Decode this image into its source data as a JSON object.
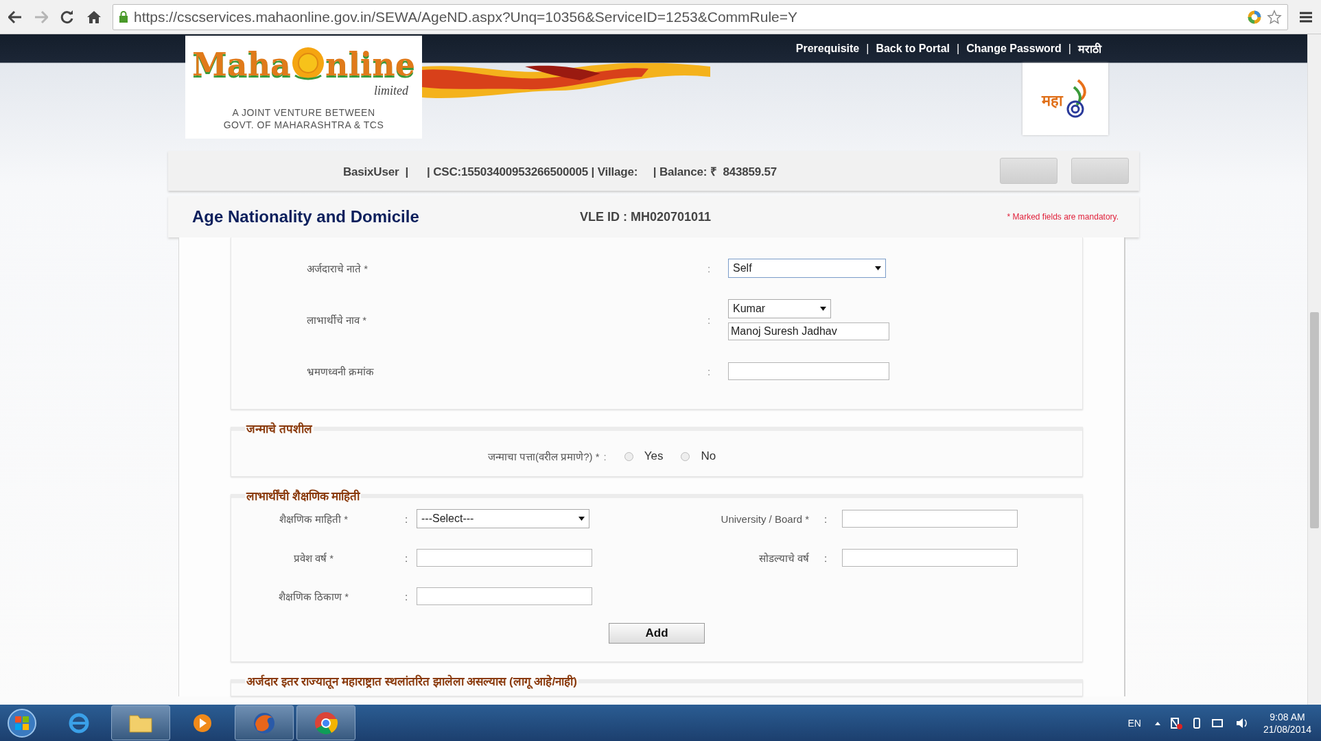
{
  "browser": {
    "url": "https://cscservices.mahaonline.gov.in/SEWA/AgeND.aspx?Unq=10356&ServiceID=1253&CommRule=Y"
  },
  "top_links": [
    "Prerequisite",
    "Back to Portal",
    "Change Password",
    "मराठी"
  ],
  "top_link_dividers": [
    "|",
    "|",
    "|"
  ],
  "logo": {
    "name_left": "Maha",
    "name_right": "nline",
    "suffix": "limited",
    "tagline": [
      "A JOINT VENTURE BETWEEN",
      "GOVT. OF MAHARASHTRA & TCS"
    ]
  },
  "emblem": {
    "text": "महा"
  },
  "user_bar": {
    "line": "BasixUser  |      | CSC:15503400953266500005 | Village:     | Balance: ₹  843859.57"
  },
  "title_bar": {
    "title": "Age Nationality and Domicile",
    "vle_id": "VLE ID : MH020701011",
    "mandatory_note": "* Marked fields are mandatory."
  },
  "applicant_section": {
    "rows": [
      {
        "kind": "select",
        "label": "अर्जदाराचे नाते *",
        "sep": ":",
        "value": "Self"
      },
      {
        "kind": "name",
        "label": "लाभार्थीचे नाव *",
        "sep": ":",
        "prefix": "Kumar",
        "value": "Manoj Suresh Jadhav"
      },
      {
        "kind": "text",
        "label": "भ्रमणध्वनी क्रमांक",
        "sep": ":"
      }
    ]
  },
  "birth_section": {
    "legend": "जन्माचे तपशील",
    "question": "जन्माचा पत्ता(वरील प्रमाणे?) *",
    "sep": ":",
    "options": [
      {
        "label": "Yes",
        "selected": false
      },
      {
        "label": "No",
        "selected": false
      }
    ]
  },
  "education_section": {
    "legend": "लाभार्थींची शैक्षणिक माहिती",
    "fields": [
      {
        "kind": "select",
        "label": "शैक्षणिक माहिती *",
        "sep": ":",
        "value": "---Select---"
      },
      {
        "kind": "text",
        "label": "University / Board *",
        "sep": ":"
      },
      {
        "kind": "text",
        "label": "प्रवेश वर्ष *",
        "sep": ":"
      },
      {
        "kind": "text",
        "label": "सोडल्याचे वर्ष",
        "sep": ":"
      },
      {
        "kind": "text",
        "label": "शैक्षणिक ठिकाण *",
        "sep": ":"
      }
    ],
    "button": "Add"
  },
  "migration_section": {
    "legend": "अर्जदार इतर राज्यातून महाराष्ट्रात स्थलांतरित झालेला असल्यास (लागू आहे/नाही)"
  },
  "taskbar": {
    "language": "EN",
    "time": "9:08 AM",
    "date": "21/08/2014"
  }
}
